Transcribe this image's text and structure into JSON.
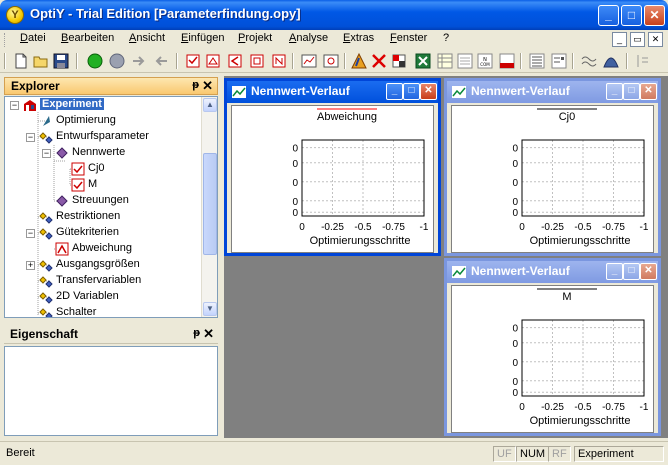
{
  "window": {
    "title": "OptiY - Trial Edition [Parameterfindung.opy]",
    "app_icon_letter": "Y",
    "min": "_",
    "max": "□",
    "close": "✕"
  },
  "menu": [
    "Datei",
    "Bearbeiten",
    "Ansicht",
    "Einfügen",
    "Projekt",
    "Analyse",
    "Extras",
    "Fenster",
    "?"
  ],
  "explorer": {
    "title": "Explorer",
    "pin": "ᵽ",
    "close": "✕",
    "tree": [
      {
        "label": "Experiment",
        "level": 0,
        "expander": "−",
        "icon": "experiment-icon",
        "selected": true
      },
      {
        "label": "Optimierung",
        "level": 1,
        "expander": "",
        "icon": "optimization-icon"
      },
      {
        "label": "Entwurfsparameter",
        "level": 1,
        "expander": "−",
        "icon": "parameter-group-icon"
      },
      {
        "label": "Nennwerte",
        "level": 2,
        "expander": "−",
        "icon": "nominal-values-icon"
      },
      {
        "label": "Cj0",
        "level": 3,
        "expander": "",
        "icon": "variable-icon"
      },
      {
        "label": "M",
        "level": 3,
        "expander": "",
        "icon": "variable-icon"
      },
      {
        "label": "Streuungen",
        "level": 2,
        "expander": "",
        "icon": "nominal-values-icon"
      },
      {
        "label": "Restriktionen",
        "level": 1,
        "expander": "",
        "icon": "parameter-group-icon"
      },
      {
        "label": "Gütekriterien",
        "level": 1,
        "expander": "−",
        "icon": "parameter-group-icon"
      },
      {
        "label": "Abweichung",
        "level": 2,
        "expander": "",
        "icon": "criterion-icon"
      },
      {
        "label": "Ausgangsgrößen",
        "level": 1,
        "expander": "+",
        "icon": "parameter-group-icon"
      },
      {
        "label": "Transfervariablen",
        "level": 1,
        "expander": "",
        "icon": "parameter-group-icon"
      },
      {
        "label": "2D Variablen",
        "level": 1,
        "expander": "",
        "icon": "parameter-group-icon"
      },
      {
        "label": "Schalter",
        "level": 1,
        "expander": "",
        "icon": "parameter-group-icon"
      }
    ]
  },
  "properties": {
    "title": "Eigenschaft",
    "pin": "ᵽ",
    "close": "✕"
  },
  "charts": [
    {
      "window_title": "Nennwert-Verlauf",
      "active": true,
      "chart_title": "Abweichung",
      "type": "line",
      "xlabel": "Optimierungsschritte",
      "x_ticks": [
        "0",
        "-0.25",
        "-0.5",
        "-0.75",
        "-1"
      ],
      "y_ticks": [
        "0",
        "0",
        "0",
        "0",
        "0"
      ],
      "series": []
    },
    {
      "window_title": "Nennwert-Verlauf",
      "active": false,
      "chart_title": "Cj0",
      "type": "line",
      "xlabel": "Optimierungsschritte",
      "x_ticks": [
        "0",
        "-0.25",
        "-0.5",
        "-0.75",
        "-1"
      ],
      "y_ticks": [
        "0",
        "0",
        "0",
        "0",
        "0"
      ],
      "series": []
    },
    {
      "window_title": "Nennwert-Verlauf",
      "active": false,
      "chart_title": "M",
      "type": "line",
      "xlabel": "Optimierungsschritte",
      "x_ticks": [
        "0",
        "-0.25",
        "-0.5",
        "-0.75",
        "-1"
      ],
      "y_ticks": [
        "0",
        "0",
        "0",
        "0",
        "0"
      ],
      "series": []
    }
  ],
  "chart_data": [
    {
      "type": "line",
      "title": "Abweichung",
      "xlabel": "Optimierungsschritte",
      "ylabel": "",
      "x_ticks": [
        "0",
        "-0.25",
        "-0.5",
        "-0.75",
        "-1"
      ],
      "y_ticks": [
        "0",
        "0",
        "0",
        "0",
        "0"
      ],
      "xlim": [
        0,
        -1
      ],
      "grid": true,
      "series": []
    },
    {
      "type": "line",
      "title": "Cj0",
      "xlabel": "Optimierungsschritte",
      "ylabel": "",
      "x_ticks": [
        "0",
        "-0.25",
        "-0.5",
        "-0.75",
        "-1"
      ],
      "y_ticks": [
        "0",
        "0",
        "0",
        "0",
        "0"
      ],
      "xlim": [
        0,
        -1
      ],
      "grid": true,
      "series": []
    },
    {
      "type": "line",
      "title": "M",
      "xlabel": "Optimierungsschritte",
      "ylabel": "",
      "x_ticks": [
        "0",
        "-0.25",
        "-0.5",
        "-0.75",
        "-1"
      ],
      "y_ticks": [
        "0",
        "0",
        "0",
        "0",
        "0"
      ],
      "xlim": [
        0,
        -1
      ],
      "grid": true,
      "series": []
    }
  ],
  "statusbar": {
    "ready": "Bereit",
    "uf": "UF",
    "num": "NUM",
    "rf": "RF",
    "mode": "Experiment"
  },
  "colors": {
    "accent": "#0045d8",
    "title_underline_active": "#ff0000",
    "selection": "#316ac5"
  }
}
